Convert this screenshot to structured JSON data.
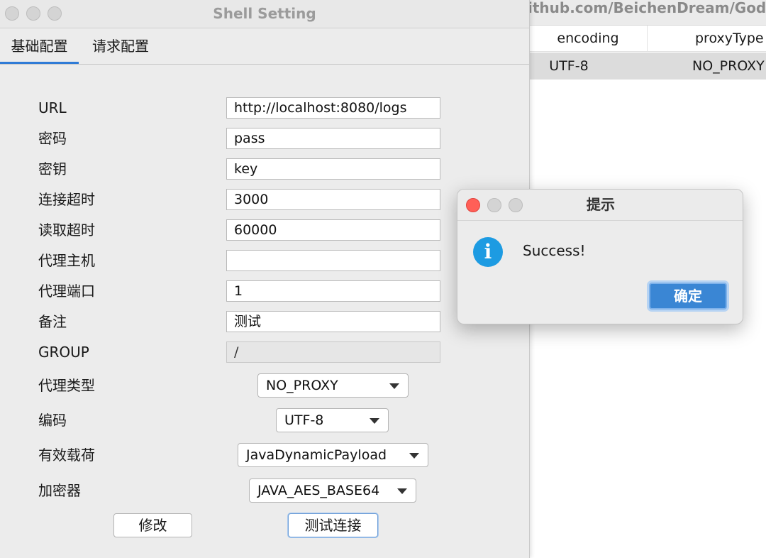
{
  "background_window": {
    "title": "ithub.com/BeichenDream/Godzilla",
    "table": {
      "headers": [
        "encoding",
        "proxyType"
      ],
      "rows": [
        [
          "UTF-8",
          "NO_PROXY"
        ]
      ]
    }
  },
  "shell_window": {
    "title": "Shell Setting",
    "tabs": [
      {
        "label": "基础配置",
        "active": true
      },
      {
        "label": "请求配置",
        "active": false
      }
    ],
    "fields": {
      "url": {
        "label": "URL",
        "value": "http://localhost:8080/logs"
      },
      "password": {
        "label": "密码",
        "value": "pass"
      },
      "key": {
        "label": "密钥",
        "value": "key"
      },
      "conn_timeout": {
        "label": "连接超时",
        "value": "3000"
      },
      "read_timeout": {
        "label": "读取超时",
        "value": "60000"
      },
      "proxy_host": {
        "label": "代理主机",
        "value": ""
      },
      "proxy_port": {
        "label": "代理端口",
        "value": "1"
      },
      "remark": {
        "label": "备注",
        "value": "测试"
      },
      "group": {
        "label": "GROUP",
        "value": "/"
      }
    },
    "selects": {
      "proxy_type": {
        "label": "代理类型",
        "value": "NO_PROXY"
      },
      "encoding": {
        "label": "编码",
        "value": "UTF-8"
      },
      "payload": {
        "label": "有效载荷",
        "value": "JavaDynamicPayload"
      },
      "cryption": {
        "label": "加密器",
        "value": "JAVA_AES_BASE64"
      }
    },
    "buttons": {
      "modify": "修改",
      "test_connection": "测试连接"
    }
  },
  "dialog": {
    "title": "提示",
    "icon": "info-icon",
    "icon_glyph": "i",
    "message": "Success!",
    "ok_label": "确定",
    "accent_color": "#3a86d4"
  },
  "colors": {
    "tab_indicator": "#2f7bd6",
    "close_button": "#ff5f57",
    "info_icon": "#1d9be2"
  }
}
